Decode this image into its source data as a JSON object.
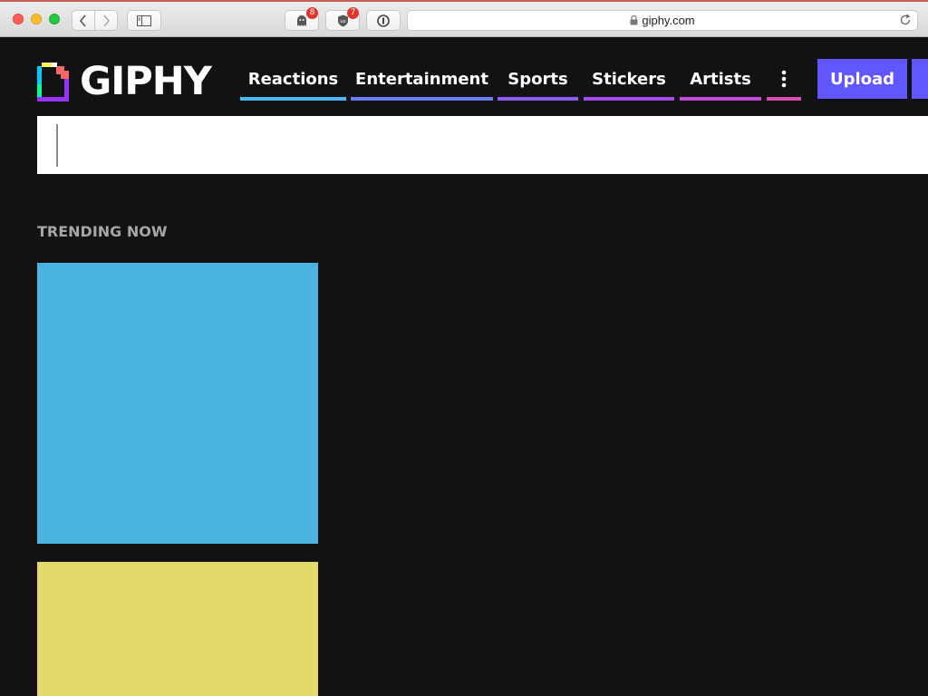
{
  "browser": {
    "url": "giphy.com",
    "extensions": [
      {
        "name": "ghost-extension",
        "badge": "8"
      },
      {
        "name": "ublock-extension",
        "badge": "7"
      },
      {
        "name": "onepassword-extension"
      }
    ]
  },
  "header": {
    "logo_text": "GIPHY",
    "nav": [
      {
        "label": "Reactions",
        "color": "#4ab8ff"
      },
      {
        "label": "Entertainment",
        "color": "#6b7bff"
      },
      {
        "label": "Sports",
        "color": "#8a5cff"
      },
      {
        "label": "Stickers",
        "color": "#a54bf2"
      },
      {
        "label": "Artists",
        "color": "#c04bd6"
      }
    ],
    "more_color": "#d94fb0",
    "upload_label": "Upload",
    "upload_color": "#6157ff"
  },
  "search": {
    "value": "",
    "placeholder": ""
  },
  "trending": {
    "title": "TRENDING NOW",
    "tiles": [
      {
        "color": "#4ab3e0"
      },
      {
        "color": "#e3d96b"
      }
    ]
  }
}
